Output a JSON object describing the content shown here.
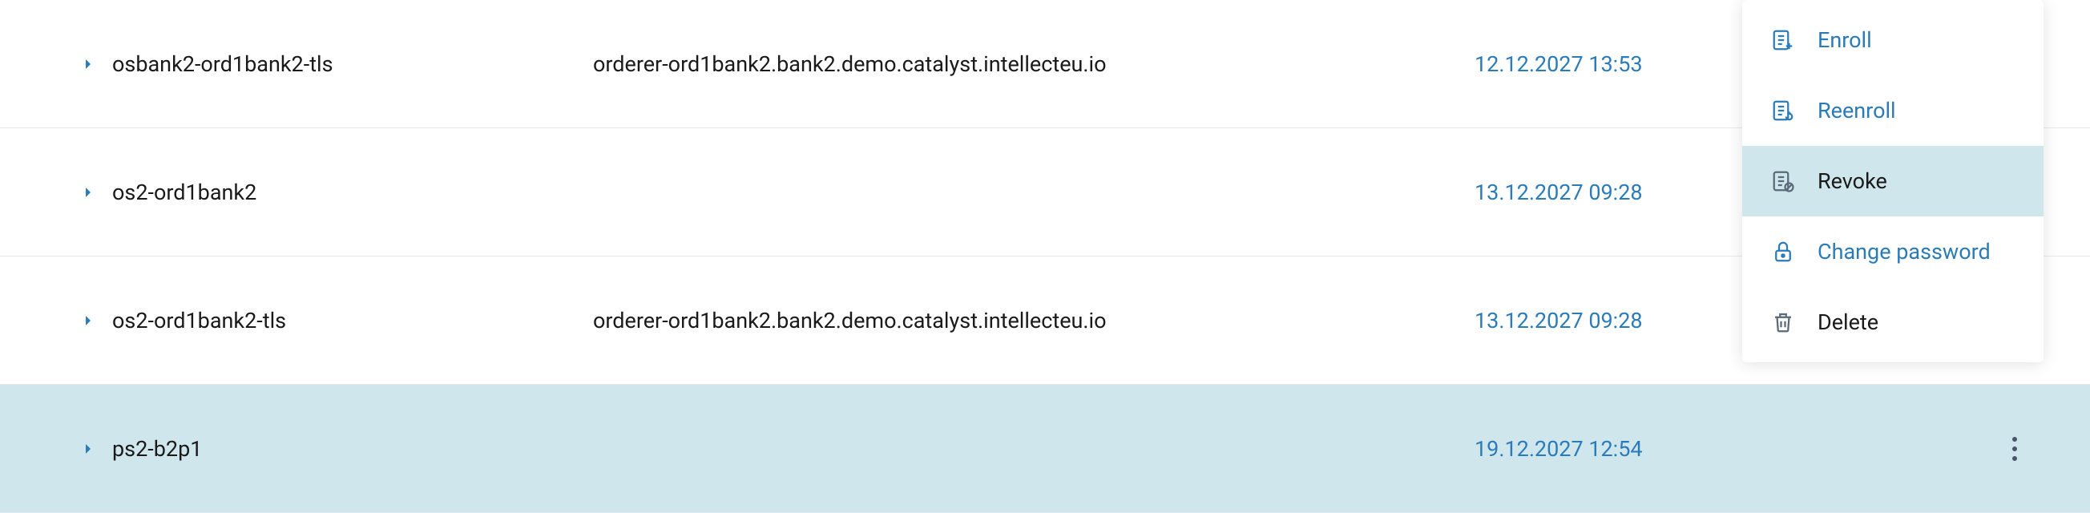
{
  "rows": [
    {
      "name": "osbank2-ord1bank2-tls",
      "host": "orderer-ord1bank2.bank2.demo.catalyst.intellecteu.io",
      "date": "12.12.2027 13:53",
      "selected": false,
      "show_kebab": false
    },
    {
      "name": "os2-ord1bank2",
      "host": "",
      "date": "13.12.2027 09:28",
      "selected": false,
      "show_kebab": false
    },
    {
      "name": "os2-ord1bank2-tls",
      "host": "orderer-ord1bank2.bank2.demo.catalyst.intellecteu.io",
      "date": "13.12.2027 09:28",
      "selected": false,
      "show_kebab": false
    },
    {
      "name": "ps2-b2p1",
      "host": "",
      "date": "19.12.2027 12:54",
      "selected": true,
      "show_kebab": true
    }
  ],
  "menu": {
    "enroll": "Enroll",
    "reenroll": "Reenroll",
    "revoke": "Revoke",
    "change_password": "Change password",
    "delete": "Delete"
  }
}
